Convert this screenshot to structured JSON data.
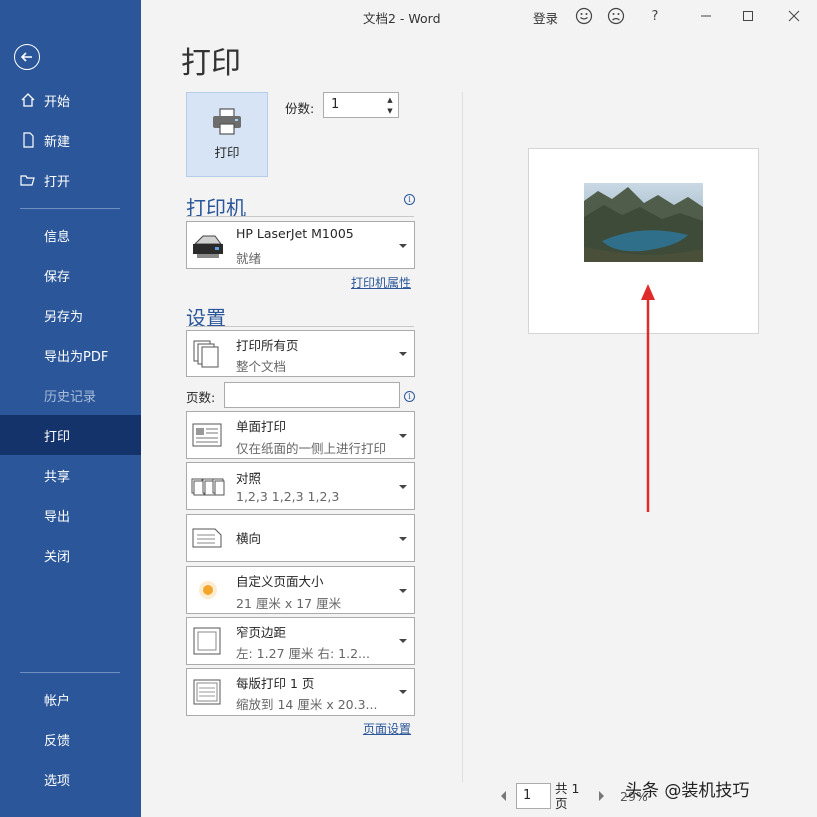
{
  "titlebar": {
    "title": "文档2  -  Word",
    "login": "登录",
    "help": "?"
  },
  "sidebar": {
    "items": [
      {
        "label": "开始",
        "icon": "home-icon"
      },
      {
        "label": "新建",
        "icon": "new-document-icon"
      },
      {
        "label": "打开",
        "icon": "open-folder-icon"
      },
      {
        "label": "信息"
      },
      {
        "label": "保存"
      },
      {
        "label": "另存为"
      },
      {
        "label": "导出为PDF"
      },
      {
        "label": "历史记录"
      },
      {
        "label": "打印"
      },
      {
        "label": "共享"
      },
      {
        "label": "导出"
      },
      {
        "label": "关闭"
      },
      {
        "label": "帐户"
      },
      {
        "label": "反馈"
      },
      {
        "label": "选项"
      }
    ]
  },
  "print": {
    "page_title": "打印",
    "button_label": "打印",
    "copies_label": "份数:",
    "copies_value": "1"
  },
  "printer": {
    "header": "打印机",
    "name": "HP LaserJet M1005",
    "status": "就绪",
    "properties_link": "打印机属性"
  },
  "settings": {
    "header": "设置",
    "print_range": {
      "title": "打印所有页",
      "subtitle": "整个文档"
    },
    "pages_label": "页数:",
    "pages_value": "",
    "sides": {
      "title": "单面打印",
      "subtitle": "仅在纸面的一侧上进行打印"
    },
    "collate": {
      "title": "对照",
      "subtitle": "1,2,3    1,2,3    1,2,3"
    },
    "orientation": {
      "title": "横向"
    },
    "paper_size": {
      "title": "自定义页面大小",
      "subtitle": "21 厘米 x 17 厘米"
    },
    "margins": {
      "title": "窄页边距",
      "subtitle": "左: 1.27 厘米    右: 1.2..."
    },
    "pages_per_sheet": {
      "title": "每版打印 1 页",
      "subtitle": "缩放到 14 厘米 x 20.3..."
    },
    "page_setup_link": "页面设置"
  },
  "preview": {
    "current_page": "1",
    "total_pages": "共 1 页",
    "zoom": "29%",
    "watermark": "头条 @装机技巧"
  },
  "colors": {
    "sidebar": "#2b579a",
    "sidebar_active": "#14336b",
    "accent_arrow": "#e02b2b"
  }
}
